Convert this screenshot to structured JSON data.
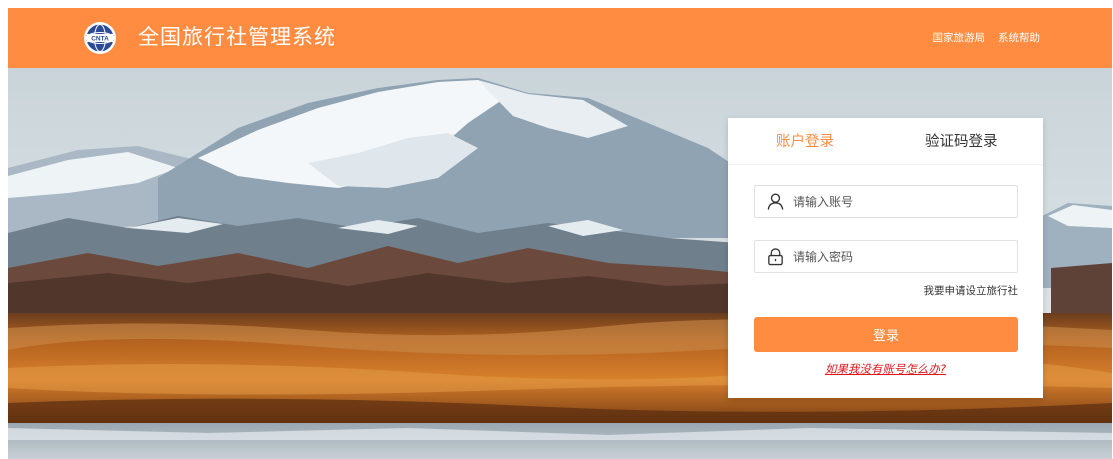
{
  "header": {
    "logo_icon": "cnta-globe-logo",
    "logo_text": "CNTA",
    "title": "全国旅行社管理系统",
    "nav": [
      "国家旅游局",
      "系统帮助"
    ],
    "color": "#ff8c41"
  },
  "hero": {
    "image": "snow-mountain-landscape"
  },
  "login": {
    "tabs": [
      {
        "label": "账户登录",
        "active": true
      },
      {
        "label": "验证码登录",
        "active": false
      }
    ],
    "account_placeholder": "请输入账号",
    "account_icon": "user-icon",
    "password_placeholder": "请输入密码",
    "password_icon": "lock-icon",
    "apply_link": "我要申请设立旅行社",
    "submit_label": "登录",
    "help_link": "如果我没有账号怎么办?",
    "accent_color": "#ff8c41",
    "help_color": "#e0161b"
  }
}
